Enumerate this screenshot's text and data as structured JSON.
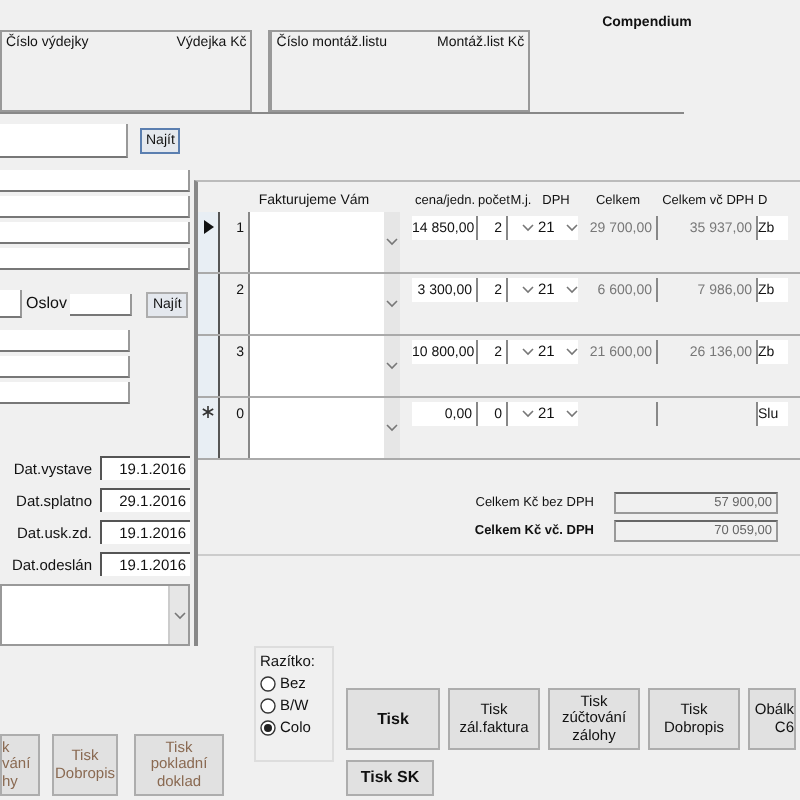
{
  "header": {
    "title": "Compendium",
    "boxes": [
      {
        "labels": [
          "Číslo výdejky",
          "Výdejka Kč"
        ]
      },
      {
        "labels": [
          "Číslo montáž.listu",
          "Montáž.list Kč"
        ]
      }
    ]
  },
  "customer": {
    "search_button": "Najít",
    "salutation_label": "Oslov",
    "salutation_button": "Najít"
  },
  "dates": [
    {
      "label": "Dat.vystave",
      "value": "19.1.2016"
    },
    {
      "label": "Dat.splatno",
      "value": "29.1.2016"
    },
    {
      "label": "Dat.usk.zd.",
      "value": "19.1.2016"
    },
    {
      "label": "Dat.odeslán",
      "value": "19.1.2016"
    }
  ],
  "grid": {
    "columns": [
      "Fakturujeme Vám",
      "cena/jedn.",
      "počet",
      "M.j.",
      "DPH",
      "Celkem",
      "Celkem vč DPH",
      "D"
    ],
    "rows": [
      {
        "kind": "item",
        "selected": true,
        "number": "1",
        "price": "14 850,00",
        "qty": "2",
        "vat": "21",
        "total": "29 700,00",
        "total_vat": "35 937,00",
        "type": "Zb"
      },
      {
        "kind": "item",
        "selected": false,
        "number": "2",
        "price": "3 300,00",
        "qty": "2",
        "vat": "21",
        "total": "6 600,00",
        "total_vat": "7 986,00",
        "type": "Zb"
      },
      {
        "kind": "item",
        "selected": false,
        "number": "3",
        "price": "10 800,00",
        "qty": "2",
        "vat": "21",
        "total": "21 600,00",
        "total_vat": "26 136,00",
        "type": "Zb"
      },
      {
        "kind": "new",
        "selected": false,
        "number": "0",
        "price": "0,00",
        "qty": "0",
        "vat": "21",
        "total": "",
        "total_vat": "",
        "type": "Slu"
      }
    ]
  },
  "totals": [
    {
      "label": "Celkem Kč bez DPH",
      "value": "57 900,00",
      "bold": false
    },
    {
      "label": "Celkem Kč vč. DPH",
      "value": "70 059,00",
      "bold": true
    }
  ],
  "stamp": {
    "title": "Razítko:",
    "options": [
      {
        "label": "Bez",
        "selected": false
      },
      {
        "label": "B/W",
        "selected": false
      },
      {
        "label": "Colo",
        "selected": true
      }
    ]
  },
  "left_buttons": [
    {
      "label": "k\nvání\nhy",
      "disabled": true
    },
    {
      "label": "Tisk\nDobropis",
      "disabled": true
    },
    {
      "label": "Tisk\npokladní\ndoklad",
      "disabled": true
    }
  ],
  "print_buttons": [
    {
      "label": "Tisk",
      "bold": true
    },
    {
      "label": "Tisk\nzál.faktura",
      "bold": false
    },
    {
      "label": "Tisk\nzúčtování\nzálohy",
      "bold": false
    },
    {
      "label": "Tisk\nDobropis",
      "bold": false
    },
    {
      "label": "Obálk\nC6",
      "bold": false
    }
  ],
  "extra_button": {
    "label": "Tisk SK",
    "bold": true
  }
}
